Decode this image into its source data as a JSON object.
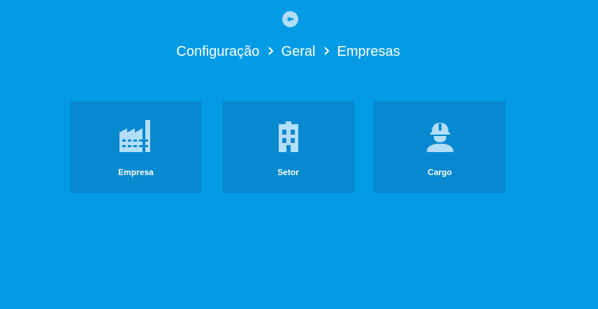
{
  "header": {
    "back_icon": "arrow-left-circle-icon",
    "breadcrumb": [
      {
        "label": "Configuração"
      },
      {
        "label": "Geral"
      },
      {
        "label": "Empresas"
      }
    ],
    "separator_icon": "chevron-right-icon"
  },
  "cards": [
    {
      "label": "Empresa",
      "icon": "factory-icon"
    },
    {
      "label": "Setor",
      "icon": "building-icon"
    },
    {
      "label": "Cargo",
      "icon": "worker-helmet-icon"
    }
  ],
  "colors": {
    "background": "#049BE5",
    "card": "#0789CF",
    "icon": "#B3DEF7",
    "text": "#FFFFFF"
  }
}
